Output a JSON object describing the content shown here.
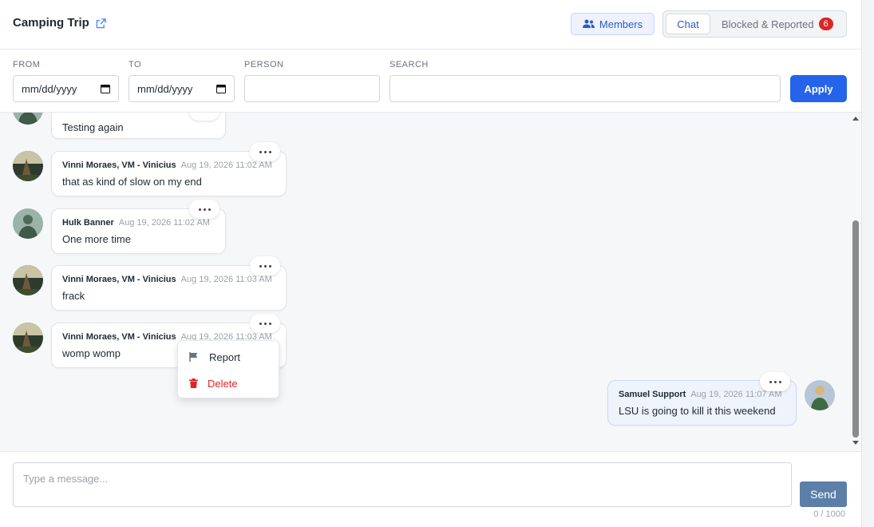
{
  "header": {
    "title": "Camping Trip",
    "members_label": "Members",
    "tabs": [
      {
        "label": "Chat",
        "active": true
      },
      {
        "label": "Blocked & Reported",
        "count": "6"
      }
    ]
  },
  "filters": {
    "from_label": "FROM",
    "from_value": "mm/dd/yyyy",
    "to_label": "TO",
    "to_value": "mm/dd/yyyy",
    "person_label": "PERSON",
    "person_value": "",
    "search_label": "SEARCH",
    "search_value": "",
    "apply_label": "Apply"
  },
  "messages": [
    {
      "author": "",
      "time": "",
      "text": "Testing again",
      "avatar": "hulk"
    },
    {
      "author": "Vinni Moraes, VM - Vinicius",
      "time": "Aug 19, 2026 11:02 AM",
      "text": "that as kind of slow on my end",
      "avatar": "vinni"
    },
    {
      "author": "Hulk Banner",
      "time": "Aug 19, 2026 11:02 AM",
      "text": "One more time",
      "avatar": "hulk"
    },
    {
      "author": "Vinni Moraes, VM - Vinicius",
      "time": "Aug 19, 2026 11:03 AM",
      "text": "frack",
      "avatar": "vinni"
    },
    {
      "author": "Vinni Moraes, VM - Vinicius",
      "time": "Aug 19, 2026 11:03 AM",
      "text": "womp womp",
      "avatar": "vinni"
    },
    {
      "author": "Samuel Support",
      "time": "Aug 19, 2026 11:07 AM",
      "text": "LSU is going to kill it this weekend",
      "avatar": "samuel",
      "own": true
    }
  ],
  "context_menu": {
    "report_label": "Report",
    "delete_label": "Delete"
  },
  "composer": {
    "placeholder": "Type a message...",
    "send_label": "Send",
    "counter": "0 / 1000"
  },
  "colors": {
    "accent": "#2563eb",
    "badge": "#dc2626",
    "send": "#5b7fa8"
  }
}
